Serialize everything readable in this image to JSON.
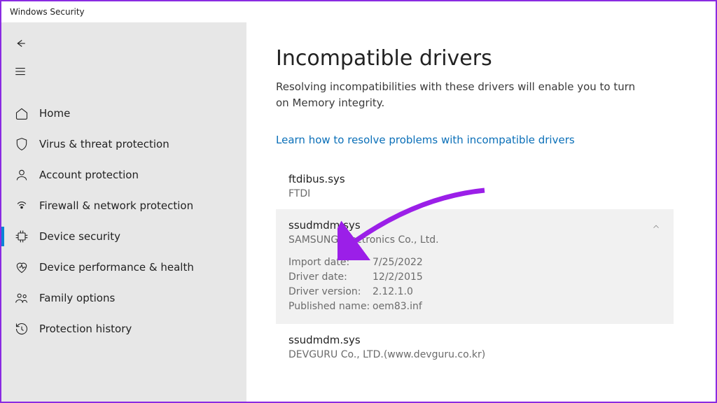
{
  "window": {
    "title": "Windows Security"
  },
  "sidebar": {
    "items": [
      {
        "label": "Home"
      },
      {
        "label": "Virus & threat protection"
      },
      {
        "label": "Account protection"
      },
      {
        "label": "Firewall & network protection"
      },
      {
        "label": "Device security"
      },
      {
        "label": "Device performance & health"
      },
      {
        "label": "Family options"
      },
      {
        "label": "Protection history"
      }
    ]
  },
  "main": {
    "heading": "Incompatible drivers",
    "subtitle": "Resolving incompatibilities with these drivers will enable you to turn on Memory integrity.",
    "help_link": "Learn how to resolve problems with incompatible drivers",
    "drivers": [
      {
        "file": "ftdibus.sys",
        "vendor": "FTDI"
      },
      {
        "file": "ssudmdm.sys",
        "vendor": "SAMSUNG Electronics Co., Ltd.",
        "details": {
          "import_date_label": "Import date:",
          "import_date": "7/25/2022",
          "driver_date_label": "Driver date:",
          "driver_date": "12/2/2015",
          "driver_version_label": "Driver version:",
          "driver_version": "2.12.1.0",
          "published_name_label": "Published name:",
          "published_name": "oem83.inf"
        }
      },
      {
        "file": "ssudmdm.sys",
        "vendor": "DEVGURU Co., LTD.(www.devguru.co.kr)"
      }
    ]
  }
}
